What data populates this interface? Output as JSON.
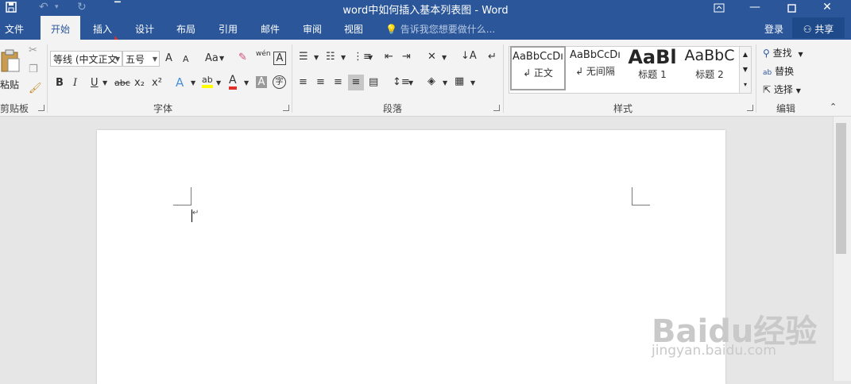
{
  "window": {
    "title": "word中如何插入基本列表图 - Word",
    "qat_save_icon": "save-icon",
    "qat_undo_icon": "undo-icon",
    "qat_redo_icon": "redo-icon",
    "qat_customize_icon": "customize-icon",
    "ribbon_display_icon": "ribbon-display-icon",
    "minimize_icon": "minimize-icon",
    "maximize_icon": "maximize-icon",
    "close_icon": "close-icon"
  },
  "tabs": [
    {
      "label": "文件",
      "active": false
    },
    {
      "label": "开始",
      "active": true
    },
    {
      "label": "插入",
      "active": false
    },
    {
      "label": "设计",
      "active": false
    },
    {
      "label": "布局",
      "active": false
    },
    {
      "label": "引用",
      "active": false
    },
    {
      "label": "邮件",
      "active": false
    },
    {
      "label": "审阅",
      "active": false
    },
    {
      "label": "视图",
      "active": false
    }
  ],
  "tell_me": "告诉我您想要做什么...",
  "account": {
    "login_label": "登录",
    "share_label": "共享"
  },
  "ribbon": {
    "clipboard": {
      "paste_label": "粘贴",
      "group_label": "剪贴板"
    },
    "font": {
      "font_name": "等线 (中文正文",
      "font_size": "五号",
      "grow_label": "A",
      "shrink_label": "A",
      "case_label": "Aa",
      "bold_label": "B",
      "italic_label": "I",
      "underline_label": "U",
      "strike_label": "abc",
      "sub_label": "x₂",
      "sup_label": "x²",
      "effects_label": "A",
      "highlight_label": "ab",
      "color_label": "A",
      "shade_label": "A",
      "phonetic_label": "wén",
      "group_label": "字体"
    },
    "paragraph": {
      "group_label": "段落"
    },
    "styles": {
      "group_label": "样式",
      "items": [
        {
          "sample": "AaBbCcDı",
          "name": "↲ 正文"
        },
        {
          "sample": "AaBbCcDı",
          "name": "↲ 无间隔"
        },
        {
          "sample": "AaBl",
          "name": "标题 1"
        },
        {
          "sample": "AaBbC",
          "name": "标题 2"
        }
      ]
    },
    "editing": {
      "find_label": "查找",
      "replace_label": "替换",
      "select_label": "选择",
      "group_label": "编辑"
    }
  },
  "watermark": {
    "brand": "Baidu经验",
    "url": "jingyan.baidu.com"
  },
  "colors": {
    "accent": "#2b579a",
    "annotation_arrow": "#e0302a"
  }
}
